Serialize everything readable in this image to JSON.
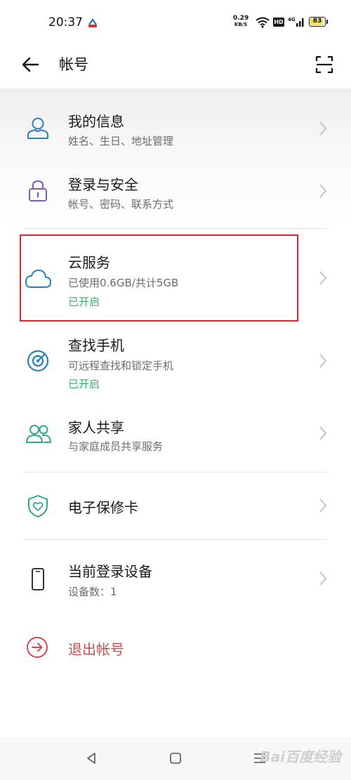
{
  "status": {
    "time": "20:37",
    "net_speed": "0.29",
    "net_unit": "KB/S",
    "hd": "HD",
    "signal_label": "4G",
    "battery": "83"
  },
  "header": {
    "title": "帐号"
  },
  "items": [
    {
      "title": "我的信息",
      "subtitle": "姓名、生日、地址管理",
      "icon": "user-icon"
    },
    {
      "title": "登录与安全",
      "subtitle": "帐号、密码、联系方式",
      "icon": "lock-icon"
    },
    {
      "title": "云服务",
      "subtitle": "已使用0.6GB/共计5GB",
      "status": "已开启",
      "icon": "cloud-icon"
    },
    {
      "title": "查找手机",
      "subtitle": "可远程查找和锁定手机",
      "status": "已开启",
      "icon": "find-phone-icon"
    },
    {
      "title": "家人共享",
      "subtitle": "与家庭成员共享服务",
      "icon": "family-icon"
    },
    {
      "title": "电子保修卡",
      "icon": "shield-heart-icon"
    },
    {
      "title": "当前登录设备",
      "subtitle": "设备数：1",
      "icon": "phone-icon"
    }
  ],
  "logout": {
    "label": "退出帐号",
    "icon": "logout-icon"
  },
  "watermark": "Bai百度经验",
  "colors": {
    "accent_green": "#2fb066",
    "danger_red": "#d34a4d",
    "highlight_border": "#d9262c",
    "icon_blue": "#2d7fb9",
    "icon_purple": "#7b5cb8",
    "icon_teal": "#2fa88a"
  }
}
